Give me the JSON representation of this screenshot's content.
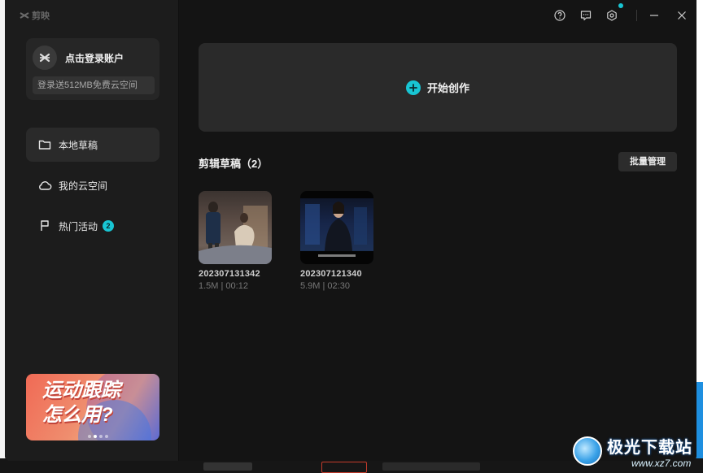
{
  "app": {
    "brand_name": "剪映"
  },
  "account": {
    "login_label": "点击登录账户",
    "cloud_promo": "登录送512MB免费云空间"
  },
  "sidebar": {
    "items": [
      {
        "label": "本地草稿",
        "icon": "folder-icon",
        "active": true
      },
      {
        "label": "我的云空间",
        "icon": "cloud-icon",
        "active": false
      },
      {
        "label": "热门活动",
        "icon": "flag-icon",
        "active": false,
        "badge": "2"
      }
    ]
  },
  "promo_banner": {
    "line1": "运动跟踪",
    "line2": "怎么用?"
  },
  "titlebar": {
    "icons": [
      "help-icon",
      "feedback-icon",
      "settings-icon",
      "minimize-icon",
      "close-icon"
    ]
  },
  "main": {
    "create_label": "开始创作",
    "drafts_title": "剪辑草稿（2）",
    "batch_manage_label": "批量管理",
    "drafts": [
      {
        "name": "202307131342",
        "meta": "1.5M | 00:12"
      },
      {
        "name": "202307121340",
        "meta": "5.9M | 02:30"
      }
    ]
  },
  "watermark": {
    "title": "极光下载站",
    "subtitle": "www.xz7.com"
  },
  "colors": {
    "accent": "#18c5d3",
    "window_bg": "#141414",
    "sidebar_bg": "#1c1c1c",
    "card_bg": "#2a2a2a"
  }
}
